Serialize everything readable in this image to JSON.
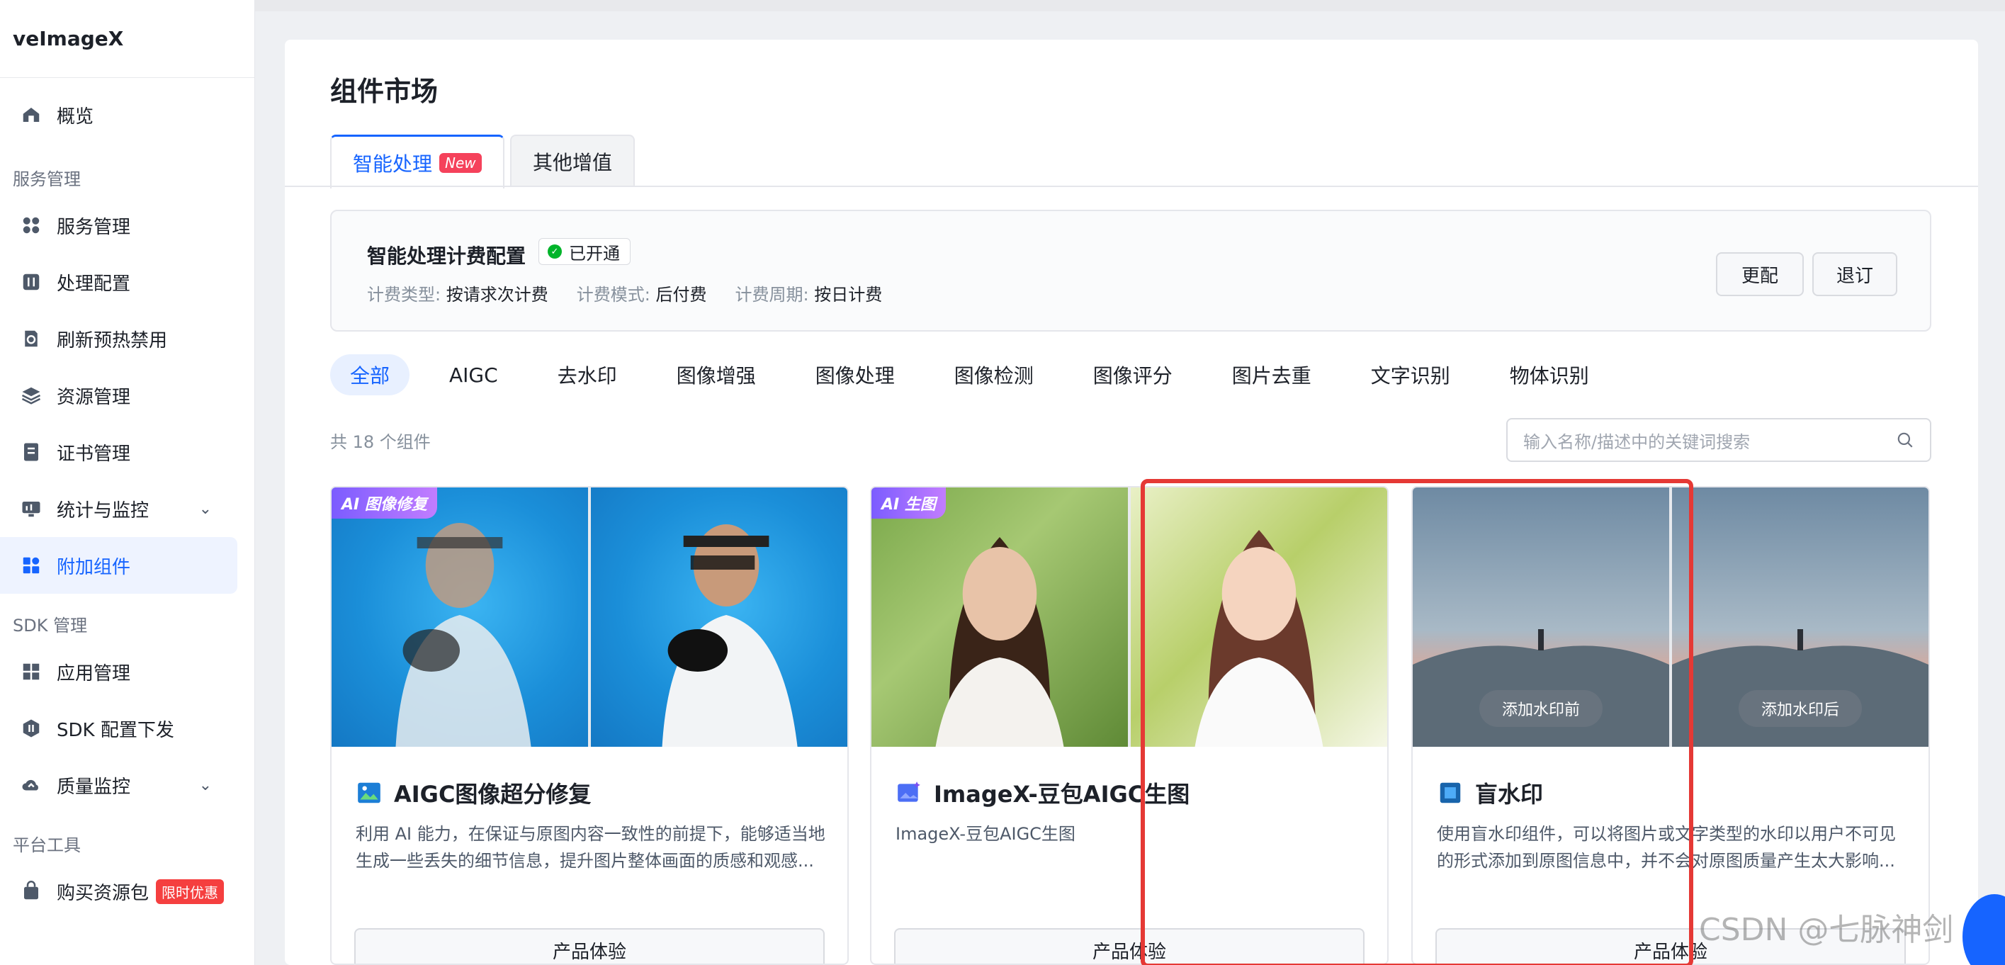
{
  "app": {
    "title": "veImageX"
  },
  "sidebar": {
    "items_top": [
      {
        "label": "概览",
        "icon": "home-icon"
      }
    ],
    "section1": "服务管理",
    "items1": [
      {
        "label": "服务管理",
        "icon": "grid-icon"
      },
      {
        "label": "处理配置",
        "icon": "sliders-icon"
      },
      {
        "label": "刷新预热禁用",
        "icon": "refresh-icon"
      },
      {
        "label": "资源管理",
        "icon": "layers-icon"
      },
      {
        "label": "证书管理",
        "icon": "certificate-icon"
      },
      {
        "label": "统计与监控",
        "icon": "monitor-icon",
        "chevron": "⌄"
      },
      {
        "label": "附加组件",
        "icon": "components-icon",
        "active": true
      }
    ],
    "section2": "SDK 管理",
    "items2": [
      {
        "label": "应用管理",
        "icon": "apps-icon"
      },
      {
        "label": "SDK 配置下发",
        "icon": "sdk-icon"
      },
      {
        "label": "质量监控",
        "icon": "cloud-icon",
        "chevron": "⌄"
      }
    ],
    "section3": "平台工具",
    "items3": [
      {
        "label": "购买资源包",
        "icon": "bag-icon",
        "badge": "限时优惠"
      }
    ]
  },
  "main": {
    "title": "组件市场",
    "tabs": [
      {
        "label": "智能处理",
        "badge": "New",
        "active": true
      },
      {
        "label": "其他增值"
      }
    ],
    "billing": {
      "title": "智能处理计费配置",
      "status": "已开通",
      "meta": [
        {
          "key": "计费类型:",
          "value": "按请求次计费"
        },
        {
          "key": "计费模式:",
          "value": "后付费"
        },
        {
          "key": "计费周期:",
          "value": "按日计费"
        }
      ],
      "btn_change": "更配",
      "btn_cancel": "退订"
    },
    "filters": [
      "全部",
      "AIGC",
      "去水印",
      "图像增强",
      "图像处理",
      "图像检测",
      "图像评分",
      "图片去重",
      "文字识别",
      "物体识别"
    ],
    "count_text": "共 18 个组件",
    "search_placeholder": "输入名称/描述中的关键词搜索",
    "cards": [
      {
        "tag": "AI 图像修复",
        "title": "AIGC图像超分修复",
        "desc": "利用 AI 能力，在保证与原图内容一致性的前提下，能够适当地生成一些丢失的细节信息，提升图片整体画面的质感和观感...",
        "button": "产品体验"
      },
      {
        "tag": "AI 生图",
        "title": "ImageX-豆包AIGC生图",
        "desc": "ImageX-豆包AIGC生图",
        "button": "产品体验"
      },
      {
        "title": "盲水印",
        "desc": "使用盲水印组件，可以将图片或文字类型的水印以用户不可见的形式添加到原图信息中，并不会对原图质量产生太大影响...",
        "button": "产品体验",
        "before_label": "添加水印前",
        "after_label": "添加水印后"
      }
    ]
  },
  "watermark": "CSDN @七脉神剑",
  "colors": {
    "accent": "#1664ff",
    "highlight": "#e53935",
    "success": "#00b42a"
  }
}
